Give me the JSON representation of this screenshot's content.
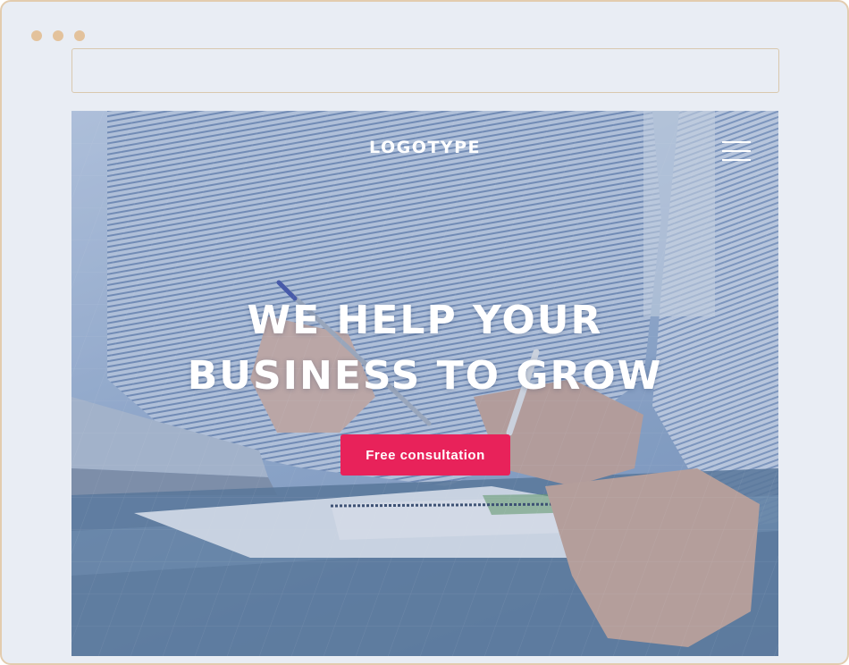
{
  "browser": {
    "window_dots": [
      "dot-1",
      "dot-2",
      "dot-3"
    ],
    "address_value": ""
  },
  "hero": {
    "logo": "LOGOTYPE",
    "menu_icon": "hamburger-menu-icon",
    "headline_line1": "WE HELP YOUR",
    "headline_line2": "BUSINESS TO GROW",
    "cta_label": "Free consultation"
  },
  "colors": {
    "frame_border": "#e3ccae",
    "window_bg": "#e9edf4",
    "dot": "#e3c29c",
    "cta_bg": "#e8225a",
    "text": "#ffffff"
  }
}
